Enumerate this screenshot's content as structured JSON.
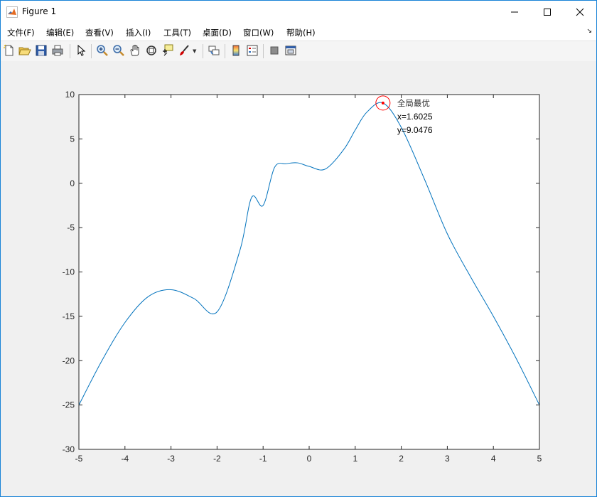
{
  "window": {
    "title": "Figure 1",
    "controls": [
      "minimize",
      "maximize",
      "close"
    ]
  },
  "menu": {
    "items": [
      "文件(F)",
      "编辑(E)",
      "查看(V)",
      "插入(I)",
      "工具(T)",
      "桌面(D)",
      "窗口(W)",
      "帮助(H)"
    ],
    "overflow_icon": "arrow-icon"
  },
  "toolbar": {
    "buttons": [
      {
        "name": "new-figure-icon"
      },
      {
        "name": "open-file-icon"
      },
      {
        "name": "save-icon"
      },
      {
        "name": "print-icon"
      },
      {
        "name": "edit-plot-arrow-icon"
      },
      {
        "name": "zoom-in-icon"
      },
      {
        "name": "zoom-out-icon"
      },
      {
        "name": "pan-hand-icon"
      },
      {
        "name": "rotate-3d-icon"
      },
      {
        "name": "data-cursor-icon"
      },
      {
        "name": "brush-icon"
      },
      {
        "name": "link-plot-icon"
      },
      {
        "name": "colorbar-icon"
      },
      {
        "name": "legend-icon"
      },
      {
        "name": "hide-plot-tools-icon"
      },
      {
        "name": "show-plot-tools-icon"
      }
    ]
  },
  "colors": {
    "line": "#0072bd",
    "marker": "#ff0000",
    "axes_bg": "#ffffff",
    "figure_bg": "#f0f0f0"
  },
  "chart_data": {
    "type": "line",
    "title": "",
    "xlabel": "",
    "ylabel": "",
    "xlim": [
      -5,
      5
    ],
    "ylim": [
      -30,
      10
    ],
    "xticks": [
      -5,
      -4,
      -3,
      -2,
      -1,
      0,
      1,
      2,
      3,
      4,
      5
    ],
    "yticks": [
      10,
      5,
      0,
      -5,
      -10,
      -15,
      -20,
      -25,
      -30
    ],
    "grid": false,
    "series": [
      {
        "x": [
          -5,
          -4.5,
          -4,
          -3.5,
          -3,
          -2.5,
          -2,
          -1.5,
          -1.25,
          -1,
          -0.75,
          -0.5,
          -0.25,
          0,
          0.35,
          0.75,
          1.0,
          1.25,
          1.6025,
          2.0,
          2.5,
          3.0,
          3.5,
          4.0,
          4.5,
          5.0
        ],
        "y": [
          -25,
          -20,
          -15.7,
          -12.8,
          -12.0,
          -13.0,
          -14.5,
          -7.5,
          -1.6,
          -2.5,
          1.8,
          2.2,
          2.3,
          1.9,
          1.6,
          3.8,
          6.0,
          8.0,
          9.0476,
          6.3,
          0.5,
          -5.7,
          -10.5,
          -15.0,
          -19.8,
          -25.0
        ]
      }
    ],
    "annotations": {
      "marker": {
        "x": 1.6025,
        "y": 9.0476,
        "shape": "circle"
      },
      "label": "全局最优",
      "x_text": "x=1.6025",
      "y_text": "y=9.0476"
    }
  }
}
